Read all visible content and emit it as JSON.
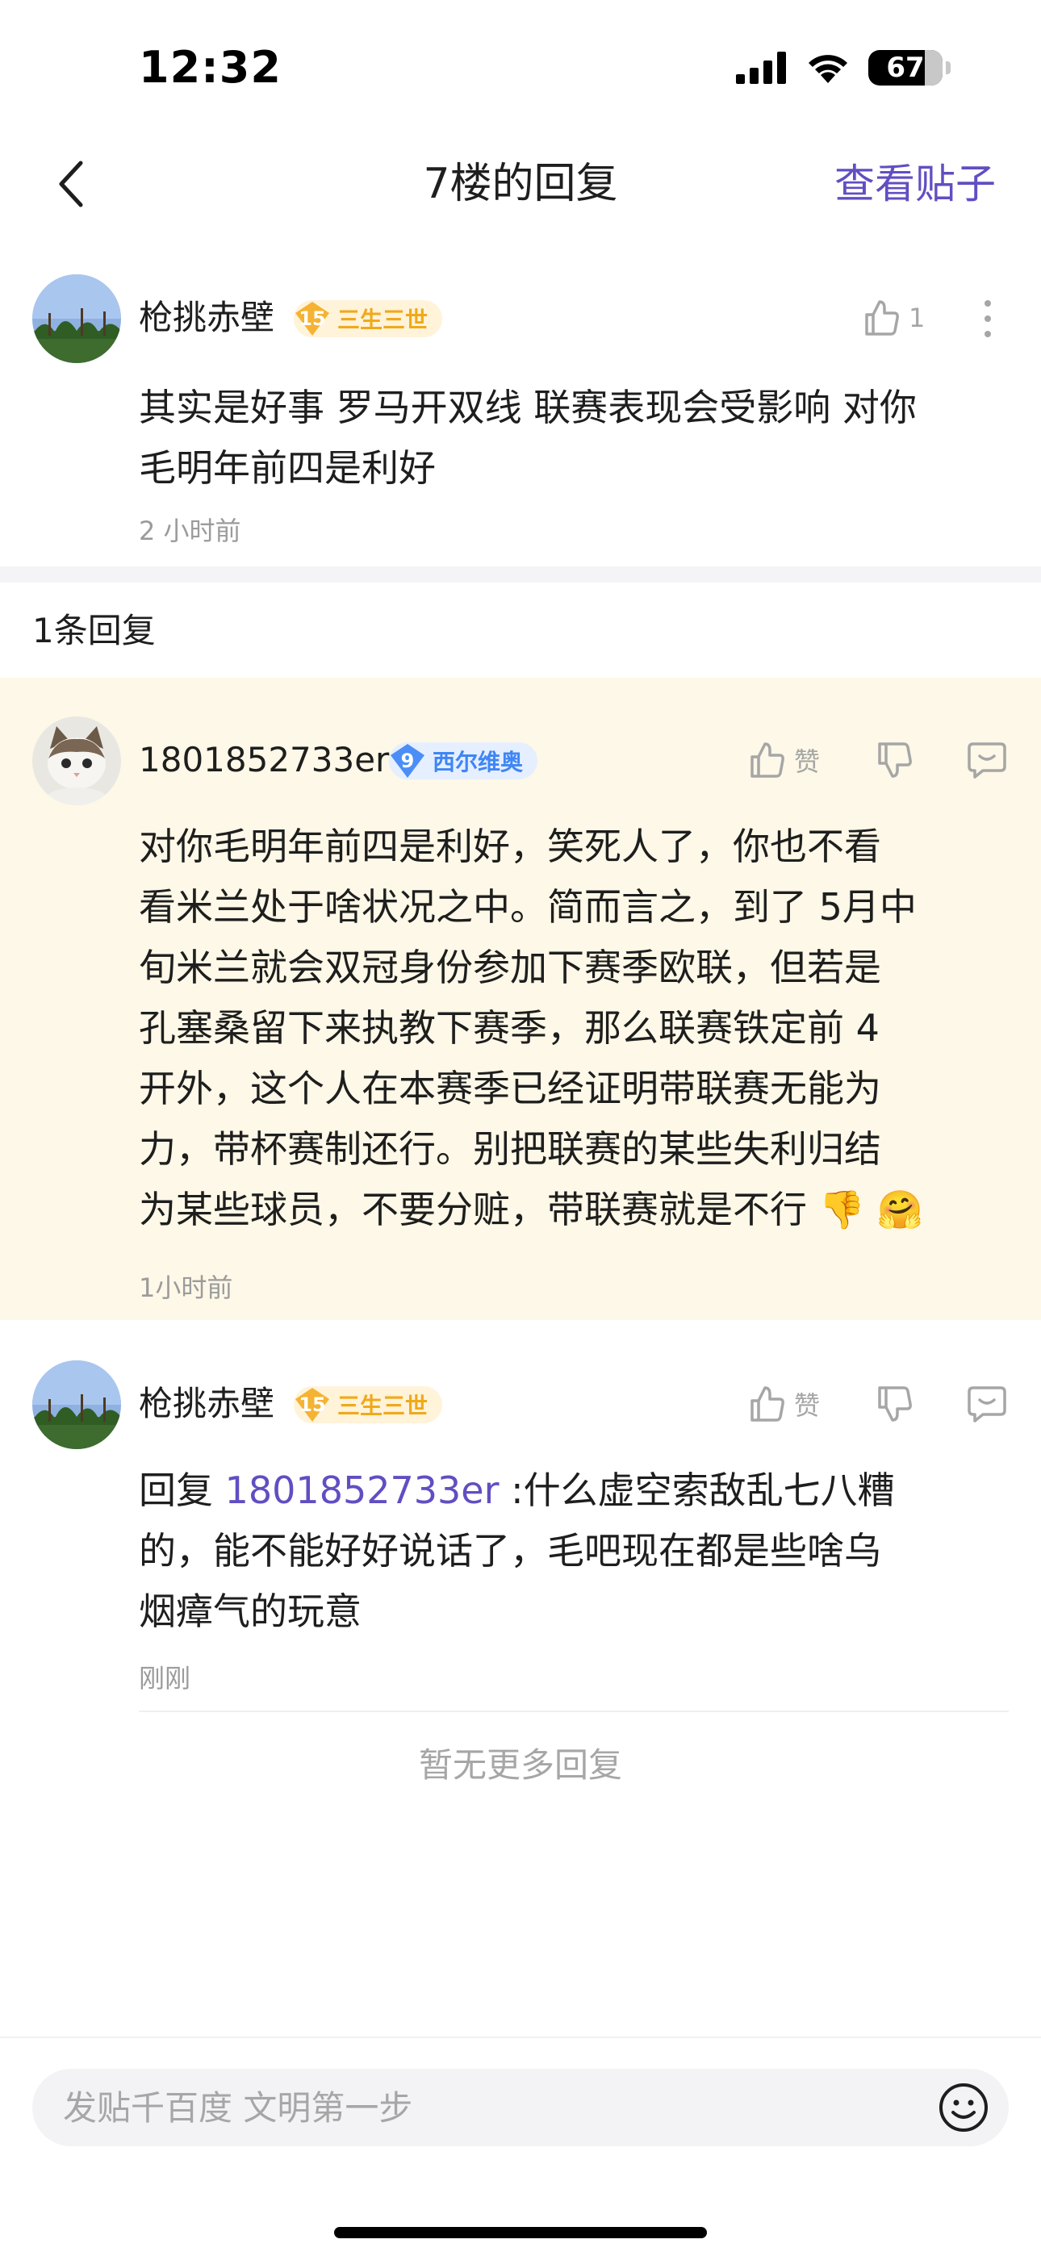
{
  "status": {
    "time": "12:32",
    "battery": "67"
  },
  "nav": {
    "title": "7楼的回复",
    "action": "查看贴子"
  },
  "main_post": {
    "username": "枪挑赤壁",
    "level": "15",
    "level_title": "三生三世",
    "like_count": "1",
    "content_line1": "其实是好事 罗马开双线 联赛表现会受影响 对你",
    "content_line2": "毛明年前四是利好",
    "time": "2 小时前"
  },
  "reply_count": "1条回复",
  "replies": [
    {
      "username": "1801852733er",
      "level": "9",
      "level_title": "西尔维奥",
      "like_label": "赞",
      "lines": [
        "对你毛明年前四是利好，笑死人了，你也不看",
        "看米兰处于啥状况之中。简而言之，到了 5月中",
        "旬米兰就会双冠身份参加下赛季欧联，但若是",
        "孔塞桑留下来执教下赛季，那么联赛铁定前 4",
        "开外，这个人在本赛季已经证明带联赛无能为",
        "力，带杯赛制还行。别把联赛的某些失利归结",
        "为某些球员，不要分赃，带联赛就是不行"
      ],
      "emojis": "👎 🤗",
      "time": "1小时前"
    },
    {
      "username": "枪挑赤壁",
      "level": "15",
      "level_title": "三生三世",
      "like_label": "赞",
      "reply_prefix": "回复 ",
      "mention": "1801852733er",
      "line1_rest": " :什么虚空索敌乱七八糟",
      "line2": "的，能不能好好说话了，毛吧现在都是些啥乌",
      "line3": "烟瘴气的玩意",
      "time": "刚刚"
    }
  ],
  "no_more": "暂无更多回复",
  "composer": {
    "placeholder": "发贴千百度 文明第一步"
  },
  "colors": {
    "accent": "#614ec2",
    "highlight_bg": "#fdf8e7",
    "gold_badge": "#f0a91b",
    "blue_badge": "#3f86f5"
  }
}
